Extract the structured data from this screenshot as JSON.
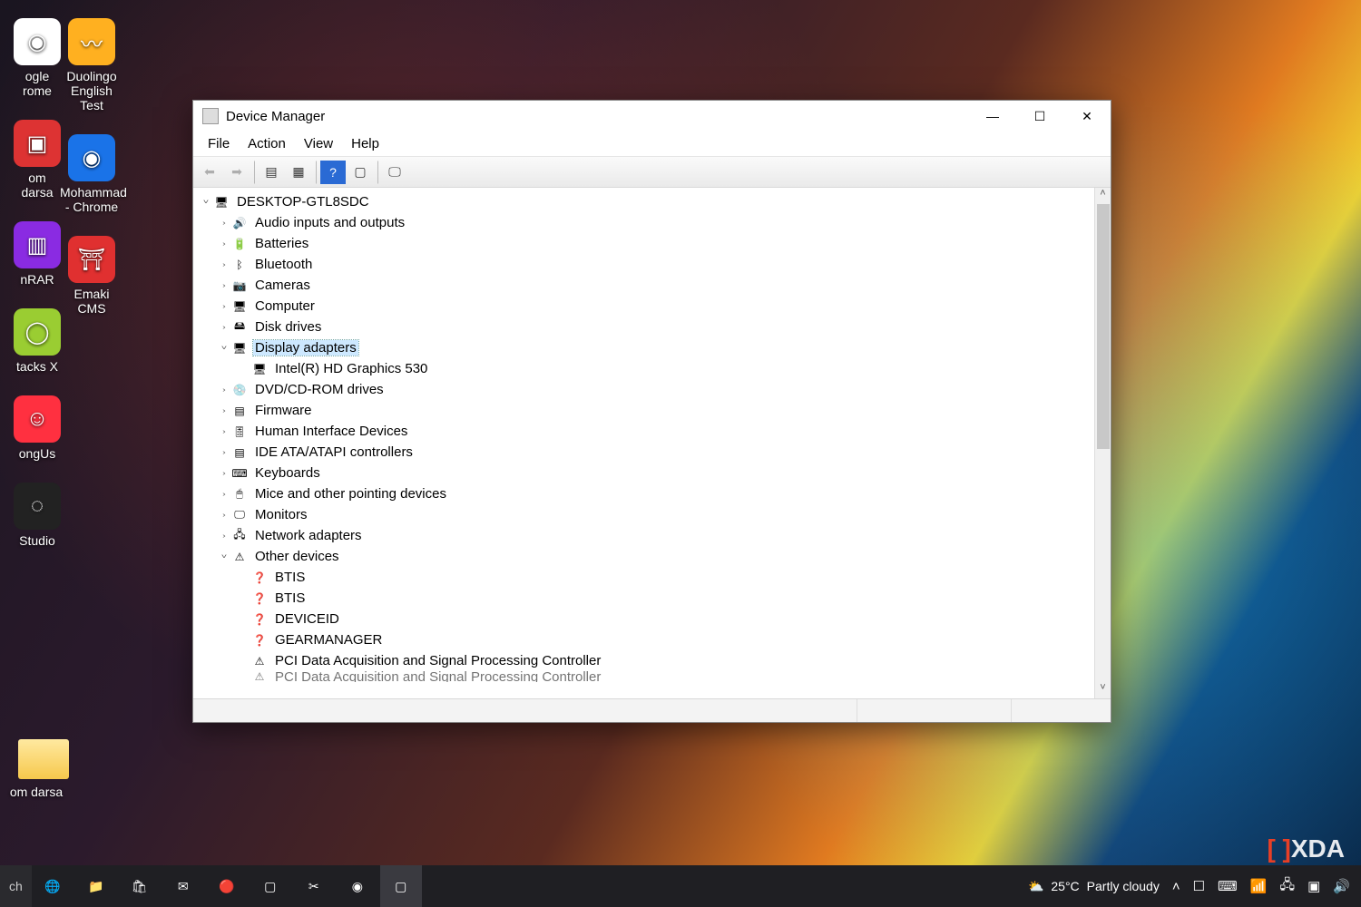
{
  "window": {
    "title": "Device Manager",
    "menus": [
      "File",
      "Action",
      "View",
      "Help"
    ],
    "toolbar": [
      "back",
      "forward",
      "properties",
      "action",
      "help",
      "uninstall",
      "scan"
    ]
  },
  "root": "DESKTOP-GTL8SDC",
  "categories": [
    {
      "label": "Audio inputs and outputs",
      "icon": "🔊",
      "expanded": false,
      "children": []
    },
    {
      "label": "Batteries",
      "icon": "🔋",
      "expanded": false,
      "children": []
    },
    {
      "label": "Bluetooth",
      "icon": "ᛒ",
      "expanded": false,
      "children": []
    },
    {
      "label": "Cameras",
      "icon": "📷",
      "expanded": false,
      "children": []
    },
    {
      "label": "Computer",
      "icon": "🖥",
      "expanded": false,
      "children": []
    },
    {
      "label": "Disk drives",
      "icon": "🖴",
      "expanded": false,
      "children": []
    },
    {
      "label": "Display adapters",
      "icon": "🖥",
      "expanded": true,
      "selected": true,
      "children": [
        {
          "label": "Intel(R) HD Graphics 530",
          "icon": "🖥"
        }
      ]
    },
    {
      "label": "DVD/CD-ROM drives",
      "icon": "💿",
      "expanded": false,
      "children": []
    },
    {
      "label": "Firmware",
      "icon": "▤",
      "expanded": false,
      "children": []
    },
    {
      "label": "Human Interface Devices",
      "icon": "🎚",
      "expanded": false,
      "children": []
    },
    {
      "label": "IDE ATA/ATAPI controllers",
      "icon": "▤",
      "expanded": false,
      "children": []
    },
    {
      "label": "Keyboards",
      "icon": "⌨",
      "expanded": false,
      "children": []
    },
    {
      "label": "Mice and other pointing devices",
      "icon": "🖱",
      "expanded": false,
      "children": []
    },
    {
      "label": "Monitors",
      "icon": "🖵",
      "expanded": false,
      "children": []
    },
    {
      "label": "Network adapters",
      "icon": "🖧",
      "expanded": false,
      "children": []
    },
    {
      "label": "Other devices",
      "icon": "⚠",
      "expanded": true,
      "children": [
        {
          "label": "BTIS",
          "icon": "❓"
        },
        {
          "label": "BTIS",
          "icon": "❓"
        },
        {
          "label": "DEVICEID",
          "icon": "❓"
        },
        {
          "label": "GEARMANAGER",
          "icon": "❓"
        },
        {
          "label": "PCI Data Acquisition and Signal Processing Controller",
          "icon": "⚠"
        },
        {
          "label": "PCI Data Acquisition and Signal Processing Controller",
          "icon": "⚠",
          "cut": true
        }
      ]
    }
  ],
  "desktop_icons_col1": [
    {
      "label": "ogle\nrome",
      "color": "#fff",
      "glyph": "◉"
    },
    {
      "label": "om\ndarsa",
      "color": "#d33",
      "glyph": "▣"
    },
    {
      "label": "nRAR",
      "color": "#8a2be2",
      "glyph": "▥"
    },
    {
      "label": "tacks X",
      "color": "#9acd32",
      "glyph": "◯"
    },
    {
      "label": "ongUs",
      "color": "#ff3040",
      "glyph": "☺"
    },
    {
      "label": "Studio",
      "color": "#222",
      "glyph": "◌"
    }
  ],
  "desktop_icons_col2": [
    {
      "label": "Duolingo\nEnglish Test",
      "color": "#ffb020",
      "glyph": "〰"
    },
    {
      "label": "Mohammad\n- Chrome",
      "color": "#1a73e8",
      "glyph": "◉"
    },
    {
      "label": "Emaki CMS",
      "color": "#e03030",
      "glyph": "⛩"
    }
  ],
  "folder": {
    "label": "om\ndarsa"
  },
  "taskbar": {
    "search": "ch",
    "apps": [
      "edge",
      "explorer",
      "store",
      "mail",
      "app1",
      "devmgr",
      "snip",
      "chrome",
      "devmgr2"
    ],
    "weather": {
      "icon": "⛅",
      "temp": "25°C",
      "text": "Partly cloudy"
    },
    "tray": [
      "˄",
      "☐",
      "⌨",
      "📶",
      "🖧",
      "▣",
      "🔊"
    ],
    "time": ""
  },
  "watermark": "XDA"
}
